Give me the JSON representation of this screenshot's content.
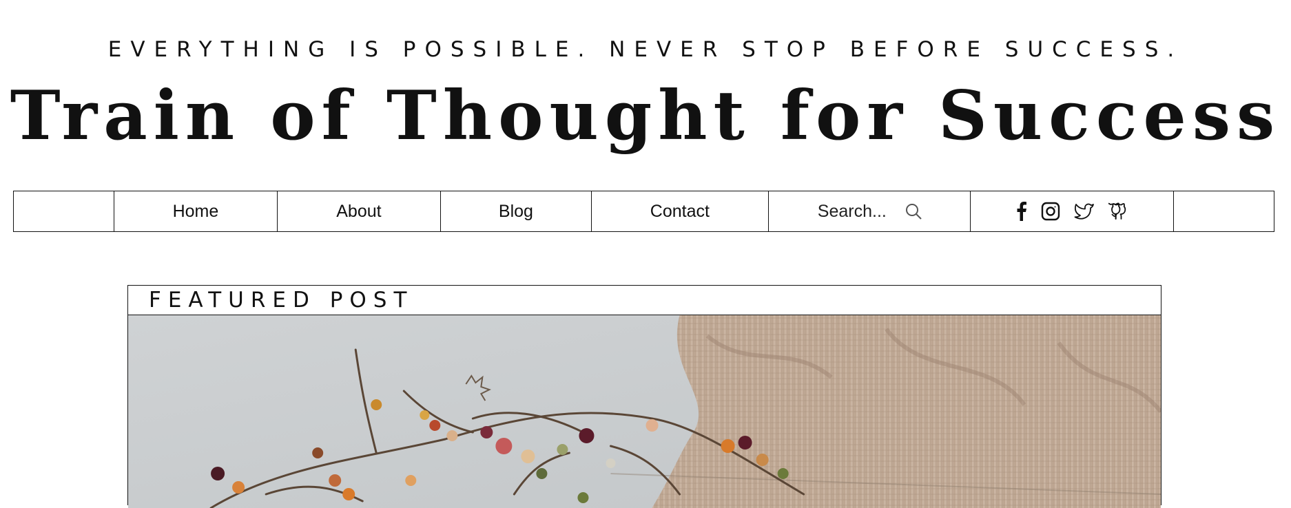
{
  "header": {
    "tagline": "EVERYTHING IS POSSIBLE. NEVER STOP BEFORE SUCCESS.",
    "title": "Train of Thought for Success"
  },
  "nav": {
    "items": [
      {
        "label": "Home"
      },
      {
        "label": "About"
      },
      {
        "label": "Blog"
      },
      {
        "label": "Contact"
      }
    ],
    "search": {
      "placeholder": "Search...",
      "icon": "search-icon"
    },
    "social": [
      "facebook-icon",
      "instagram-icon",
      "twitter-icon",
      "github-icon"
    ]
  },
  "featured": {
    "label": "FEATURED POST",
    "image": "decorative berry garland on grey surface with knitted beige blanket"
  },
  "colors": {
    "text": "#111111",
    "background": "#ffffff",
    "border": "#111111"
  }
}
